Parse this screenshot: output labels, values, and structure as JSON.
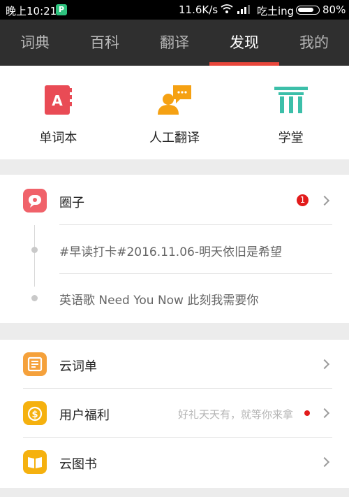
{
  "status_bar": {
    "time": "晚上10:21",
    "app_badge": "P",
    "speed": "11.6K/s",
    "carrier": "吃土ing",
    "battery_pct": "80%",
    "battery_level": 0.8
  },
  "tabs": [
    {
      "label": "词典"
    },
    {
      "label": "百科"
    },
    {
      "label": "翻译"
    },
    {
      "label": "发现",
      "active": true
    },
    {
      "label": "我的"
    }
  ],
  "tools": [
    {
      "label": "单词本",
      "icon": "wordbook-icon",
      "color": "#e94b55"
    },
    {
      "label": "人工翻译",
      "icon": "human-translate-icon",
      "color": "#f5a113"
    },
    {
      "label": "学堂",
      "icon": "school-icon",
      "color": "#3cbfa9"
    }
  ],
  "circle": {
    "title": "圈子",
    "badge": "1",
    "icon_color": "#f0626a",
    "posts": [
      "#早读打卡#2016.11.06-明天依旧是希望",
      "英语歌 Need You Now 此刻我需要你"
    ]
  },
  "menu": [
    {
      "title": "云词单",
      "icon": "cloud-wordlist-icon",
      "color": "#f5a13b"
    },
    {
      "title": "用户福利",
      "icon": "user-benefit-icon",
      "color": "#f5b10f",
      "hint": "好礼天天有，就等你来拿"
    },
    {
      "title": "云图书",
      "icon": "cloud-book-icon",
      "color": "#f5b10f"
    }
  ]
}
